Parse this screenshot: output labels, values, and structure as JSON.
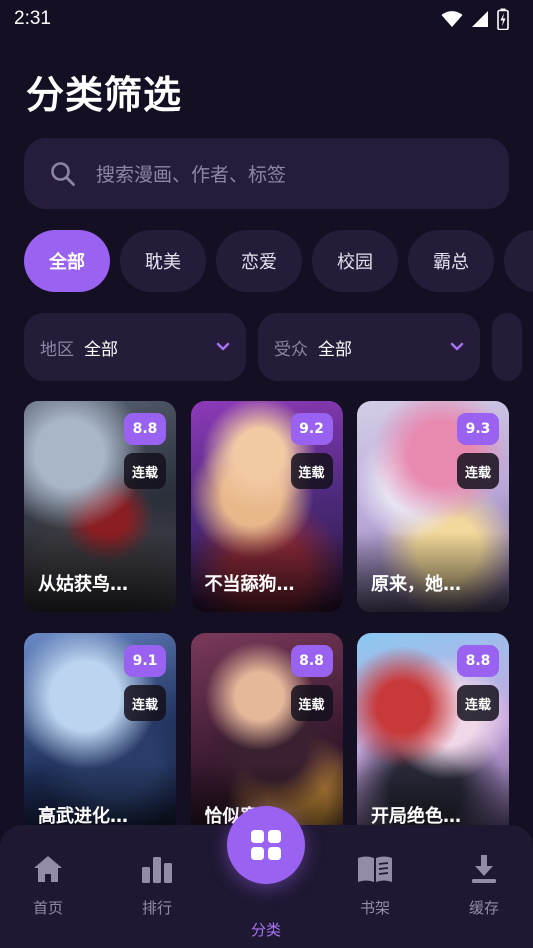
{
  "status_bar": {
    "time": "2:31",
    "icons": [
      "wifi-icon",
      "signal-icon",
      "battery-charging-icon"
    ]
  },
  "header": {
    "title": "分类筛选"
  },
  "search": {
    "placeholder": "搜索漫画、作者、标签",
    "icon": "search-icon"
  },
  "chips": [
    {
      "label": "全部",
      "active": true
    },
    {
      "label": "耽美",
      "active": false
    },
    {
      "label": "恋爱",
      "active": false
    },
    {
      "label": "校园",
      "active": false
    },
    {
      "label": "霸总",
      "active": false
    }
  ],
  "filters": [
    {
      "label": "地区",
      "value": "全部",
      "icon": "chevron-down-icon"
    },
    {
      "label": "受众",
      "value": "全部",
      "icon": "chevron-down-icon"
    }
  ],
  "comics": [
    {
      "title": "从姑获鸟…",
      "score": "8.8",
      "status": "连载"
    },
    {
      "title": "不当舔狗…",
      "score": "9.2",
      "status": "连载"
    },
    {
      "title": "原来，她…",
      "score": "9.3",
      "status": "连载"
    },
    {
      "title": "高武进化…",
      "score": "9.1",
      "status": "连载"
    },
    {
      "title": "恰似寒光…",
      "score": "8.8",
      "status": "连载"
    },
    {
      "title": "开局绝色…",
      "score": "8.8",
      "status": "连载"
    }
  ],
  "bottom_nav": {
    "items": [
      {
        "label": "首页",
        "icon": "home-icon"
      },
      {
        "label": "排行",
        "icon": "bar-chart-icon"
      },
      {
        "label": "分类",
        "icon": "grid-icon",
        "active": true
      },
      {
        "label": "书架",
        "icon": "book-icon"
      },
      {
        "label": "缓存",
        "icon": "download-icon"
      }
    ]
  },
  "colors": {
    "background": "#150f24",
    "surface": "#251c3a",
    "accent": "#9a62f0",
    "muted_text": "#8d86a3"
  }
}
